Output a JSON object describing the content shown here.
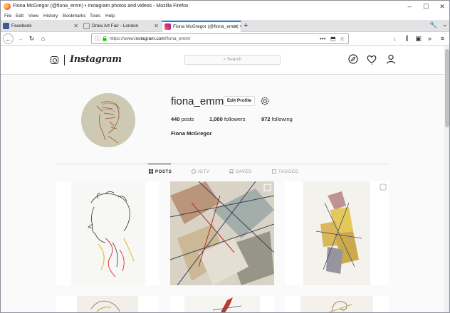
{
  "window": {
    "title": "Fiona McGregor (@fiona_emm) • Instagram photos and videos - Mozilla Firefox",
    "controls": {
      "minimize": "–",
      "maximize": "☐",
      "close": "✕"
    }
  },
  "menu": [
    "File",
    "Edit",
    "View",
    "History",
    "Bookmarks",
    "Tools",
    "Help"
  ],
  "tabs": [
    {
      "label": "Facebook",
      "icon": "facebook-icon",
      "color": "#3b5998"
    },
    {
      "label": "Draw Art Fair - London",
      "icon": "site-icon",
      "color": "#999999"
    },
    {
      "label": "Fiona McGregor (@fiona_emm) •",
      "icon": "instagram-icon",
      "color": "#c13584",
      "active": true
    }
  ],
  "toolbar": {
    "url_prefix": "https://www.",
    "url_domain": "instagram.com",
    "url_path": "/fiona_emm/",
    "new_tab": "+",
    "page_actions": "•••"
  },
  "instagram": {
    "logo_text": "Instagram",
    "search_placeholder": "Search",
    "profile": {
      "username": "fiona_emm",
      "edit_button": "Edit Profile",
      "posts_count": "440",
      "posts_label": "posts",
      "followers_count": "1,000",
      "followers_label": "followers",
      "following_count": "972",
      "following_label": "following",
      "full_name": "Fiona McGregor"
    },
    "profile_tabs": [
      "POSTS",
      "IGTV",
      "SAVED",
      "TAGGED"
    ],
    "accent": "#262626"
  }
}
